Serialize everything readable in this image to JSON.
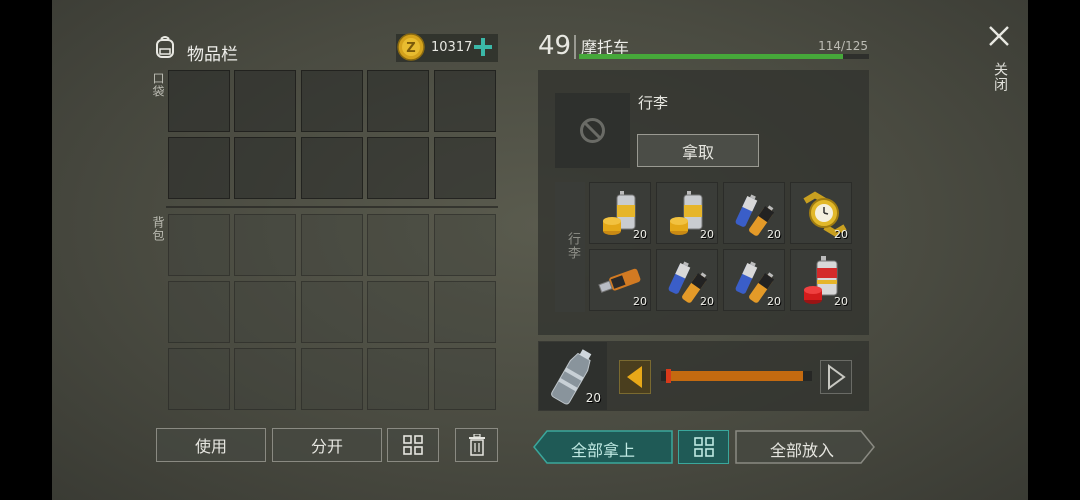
{
  "inventory": {
    "title": "物品栏",
    "coins": "10317",
    "pocket_label": "口袋",
    "backpack_label": "背包"
  },
  "buttons": {
    "use": "使用",
    "split": "分开",
    "take_all": "全部拿上",
    "put_all": "全部放入",
    "take": "拿取"
  },
  "container": {
    "level": "49",
    "name": "摩托车",
    "durability": "114/125",
    "durability_fraction": 0.912,
    "slot_title": "行李",
    "grid_label": "行李",
    "items": [
      {
        "icon": "spray-can-icon",
        "qty": "20"
      },
      {
        "icon": "spray-can-icon",
        "qty": "20"
      },
      {
        "icon": "batteries-icon",
        "qty": "20"
      },
      {
        "icon": "gold-watch-icon",
        "qty": "20"
      },
      {
        "icon": "usb-drive-icon",
        "qty": "20"
      },
      {
        "icon": "batteries-icon",
        "qty": "20"
      },
      {
        "icon": "batteries-icon",
        "qty": "20"
      },
      {
        "icon": "red-spray-can-icon",
        "qty": "20"
      }
    ]
  },
  "transfer": {
    "item_icon": "water-bottle-icon",
    "qty": "20",
    "slider_fraction": 0.03
  },
  "close": {
    "label": "关闭"
  },
  "colors": {
    "accent": "#3aa79c",
    "durability": "#46a83a",
    "slider": "#c46a10",
    "coin": "#d4a21c"
  }
}
